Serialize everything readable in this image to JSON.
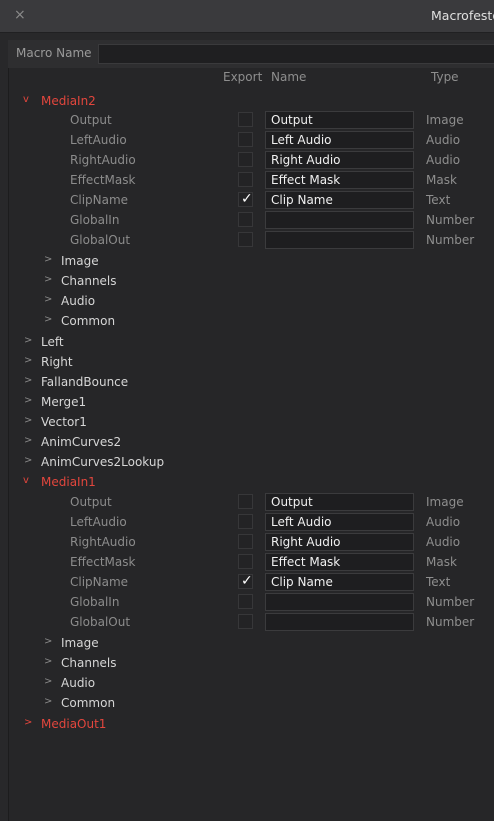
{
  "window": {
    "title": "Macrofestool",
    "close_glyph": "×"
  },
  "macro_name": {
    "label": "Macro Name",
    "value": ""
  },
  "headers": {
    "export": "Export",
    "name": "Name",
    "type": "Type"
  },
  "tree": {
    "medialn2": {
      "label": "MediaIn2",
      "inputs": [
        {
          "label": "Output",
          "exported": false,
          "name": "Output",
          "type": "Image"
        },
        {
          "label": "LeftAudio",
          "exported": false,
          "name": "Left Audio",
          "type": "Audio"
        },
        {
          "label": "RightAudio",
          "exported": false,
          "name": "Right Audio",
          "type": "Audio"
        },
        {
          "label": "EffectMask",
          "exported": false,
          "name": "Effect Mask",
          "type": "Mask"
        },
        {
          "label": "ClipName",
          "exported": true,
          "name": "Clip Name",
          "type": "Text"
        },
        {
          "label": "GlobalIn",
          "exported": false,
          "name": "",
          "type": "Number"
        },
        {
          "label": "GlobalOut",
          "exported": false,
          "name": "",
          "type": "Number"
        }
      ],
      "groups": [
        "Image",
        "Channels",
        "Audio",
        "Common"
      ]
    },
    "nodes": [
      "Left",
      "Right",
      "FallandBounce",
      "Merge1",
      "Vector1",
      "AnimCurves2",
      "AnimCurves2Lookup"
    ],
    "medialn1": {
      "label": "MediaIn1",
      "inputs": [
        {
          "label": "Output",
          "exported": false,
          "name": "Output",
          "type": "Image"
        },
        {
          "label": "LeftAudio",
          "exported": false,
          "name": "Left Audio",
          "type": "Audio"
        },
        {
          "label": "RightAudio",
          "exported": false,
          "name": "Right Audio",
          "type": "Audio"
        },
        {
          "label": "EffectMask",
          "exported": false,
          "name": "Effect Mask",
          "type": "Mask"
        },
        {
          "label": "ClipName",
          "exported": true,
          "name": "Clip Name",
          "type": "Text"
        },
        {
          "label": "GlobalIn",
          "exported": false,
          "name": "",
          "type": "Number"
        },
        {
          "label": "GlobalOut",
          "exported": false,
          "name": "",
          "type": "Number"
        }
      ],
      "groups": [
        "Image",
        "Channels",
        "Audio",
        "Common"
      ]
    },
    "mediaout1": {
      "label": "MediaOut1"
    }
  },
  "glyphs": {
    "collapsed": ">",
    "expanded": "v",
    "check": "✓"
  },
  "colors": {
    "accent_red": "#e2463d",
    "background": "#262628",
    "field_bg": "#1e1e20"
  }
}
